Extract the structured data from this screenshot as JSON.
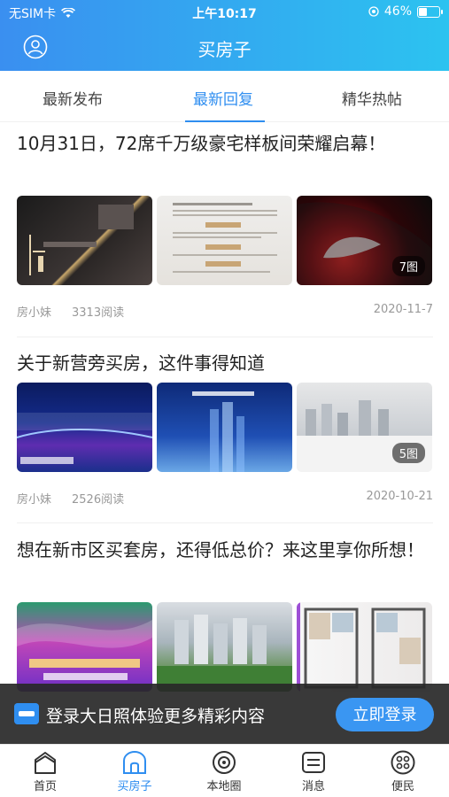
{
  "status_bar": {
    "carrier": "无SIM卡",
    "time": "上午10:17",
    "battery": "46%",
    "battery_level": 0.46
  },
  "header": {
    "title": "买房子"
  },
  "tabs": [
    {
      "label": "最新发布",
      "active": false
    },
    {
      "label": "最新回复",
      "active": true
    },
    {
      "label": "精华热帖",
      "active": false
    }
  ],
  "articles": [
    {
      "title": "10月31日，72席千万级豪宅样板间荣耀启幕！",
      "image_count": "7图",
      "author": "房小妹",
      "reads": "3313阅读",
      "date": "2020-11-7"
    },
    {
      "title": "关于新营旁买房，这件事得知道",
      "image_count": "5图",
      "author": "房小妹",
      "reads": "2526阅读",
      "date": "2020-10-21"
    },
    {
      "title": "想在新市区买套房，还得低总价？来这里享你所想！",
      "author": "",
      "reads": "",
      "date": ""
    }
  ],
  "login_banner": {
    "text": "登录大日照体验更多精彩内容",
    "button": "立即登录"
  },
  "tabbar": [
    {
      "label": "首页",
      "icon": "home-icon",
      "active": false
    },
    {
      "label": "买房子",
      "icon": "house-icon",
      "active": true
    },
    {
      "label": "本地圈",
      "icon": "circle-icon",
      "active": false
    },
    {
      "label": "消息",
      "icon": "message-icon",
      "active": false
    },
    {
      "label": "便民",
      "icon": "grid-icon",
      "active": false
    }
  ],
  "colors": {
    "accent": "#2f8ef0",
    "header_from": "#3a8ff0",
    "header_to": "#2cc3f0"
  }
}
